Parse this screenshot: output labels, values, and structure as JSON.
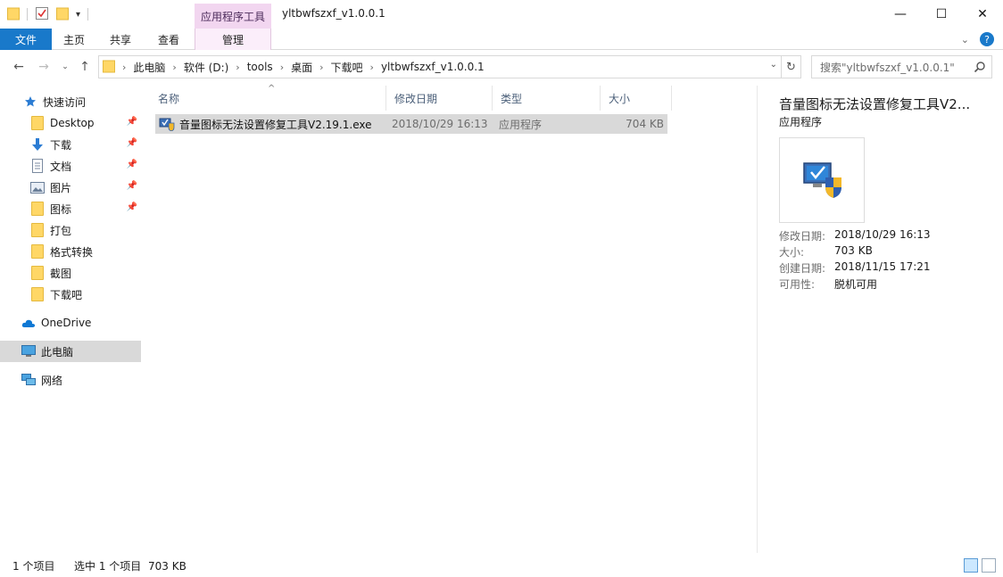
{
  "window": {
    "title": "yltbwfszxf_v1.0.0.1",
    "context_tab_group": "应用程序工具",
    "controls": {
      "minimize": "—",
      "maximize": "☐",
      "close": "✕"
    }
  },
  "ribbon": {
    "tabs": [
      {
        "label": "文件"
      },
      {
        "label": "主页"
      },
      {
        "label": "共享"
      },
      {
        "label": "查看"
      },
      {
        "label": "管理"
      }
    ],
    "help": "?"
  },
  "address": {
    "crumbs": [
      "此电脑",
      "软件 (D:)",
      "tools",
      "桌面",
      "下载吧",
      "yltbwfszxf_v1.0.0.1"
    ],
    "search_placeholder": "搜索\"yltbwfszxf_v1.0.0.1\""
  },
  "navpane": {
    "quick_access": "快速访问",
    "items": [
      {
        "label": "Desktop",
        "icon": "folder-icon",
        "pinned": true
      },
      {
        "label": "下载",
        "icon": "download-arrow-icon",
        "pinned": true
      },
      {
        "label": "文档",
        "icon": "document-icon",
        "pinned": true
      },
      {
        "label": "图片",
        "icon": "pictures-icon",
        "pinned": true
      },
      {
        "label": "图标",
        "icon": "folder-icon",
        "pinned": true
      },
      {
        "label": "打包",
        "icon": "folder-icon",
        "pinned": false
      },
      {
        "label": "格式转换",
        "icon": "folder-icon",
        "pinned": false
      },
      {
        "label": "截图",
        "icon": "folder-icon",
        "pinned": false
      },
      {
        "label": "下载吧",
        "icon": "folder-icon",
        "pinned": false
      }
    ],
    "onedrive": "OneDrive",
    "this_pc": "此电脑",
    "network": "网络"
  },
  "filelist": {
    "columns": {
      "name": "名称",
      "date": "修改日期",
      "type": "类型",
      "size": "大小"
    },
    "rows": [
      {
        "name": "音量图标无法设置修复工具V2.19.1.exe",
        "date": "2018/10/29 16:13",
        "type": "应用程序",
        "size": "704 KB"
      }
    ]
  },
  "preview": {
    "title": "音量图标无法设置修复工具V2...",
    "type": "应用程序",
    "props": [
      {
        "k": "修改日期:",
        "v": "2018/10/29 16:13"
      },
      {
        "k": "大小:",
        "v": "703 KB"
      },
      {
        "k": "创建日期:",
        "v": "2018/11/15 17:21"
      },
      {
        "k": "可用性:",
        "v": "脱机可用"
      }
    ]
  },
  "status": {
    "count": "1 个项目",
    "selected": "选中 1 个项目",
    "size": "703 KB"
  },
  "colors": {
    "accent": "#1979ca",
    "context_tab": "#f2d6f0",
    "selection": "#d9d9d9"
  }
}
